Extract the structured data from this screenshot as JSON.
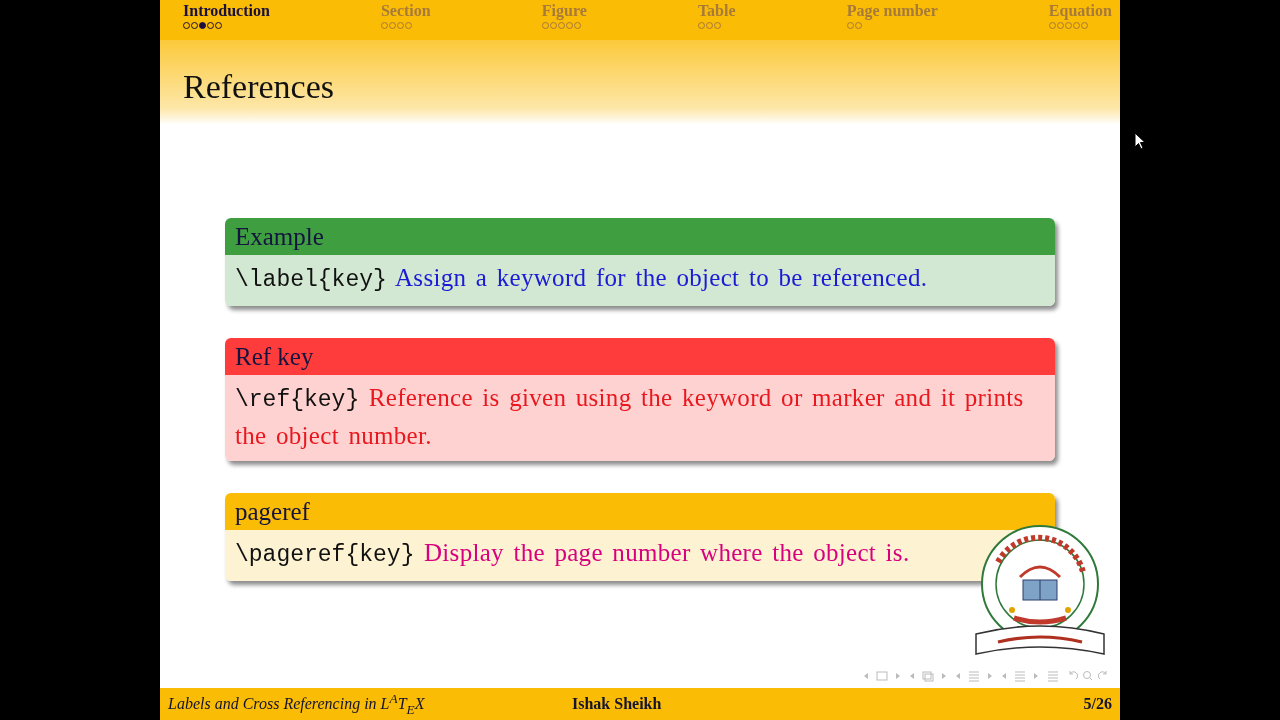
{
  "nav": {
    "sections": [
      {
        "label": "Introduction",
        "selected": true,
        "frames": [
          {
            "selected": false
          },
          {
            "selected": false
          },
          {
            "selected": true
          },
          {
            "selected": false
          },
          {
            "selected": false
          }
        ]
      },
      {
        "label": "Section",
        "selected": false,
        "frames": [
          {
            "selected": false
          },
          {
            "selected": false
          },
          {
            "selected": false
          },
          {
            "selected": false
          }
        ]
      },
      {
        "label": "Figure",
        "selected": false,
        "frames": [
          {
            "selected": false
          },
          {
            "selected": false
          },
          {
            "selected": false
          },
          {
            "selected": false
          },
          {
            "selected": false
          }
        ]
      },
      {
        "label": "Table",
        "selected": false,
        "frames": [
          {
            "selected": false
          },
          {
            "selected": false
          },
          {
            "selected": false
          }
        ]
      },
      {
        "label": "Page number",
        "selected": false,
        "frames": [
          {
            "selected": false
          },
          {
            "selected": false
          }
        ]
      },
      {
        "label": "Equation",
        "selected": false,
        "frames": [
          {
            "selected": false
          },
          {
            "selected": false
          },
          {
            "selected": false
          },
          {
            "selected": false
          },
          {
            "selected": false
          }
        ]
      }
    ]
  },
  "frame_title": "References",
  "blocks": [
    {
      "kind": "example",
      "title": "Example",
      "code": "\\label{key}",
      "text": "Assign a keyword for the object to be referenced."
    },
    {
      "kind": "alert",
      "title": "Ref key",
      "code": "\\ref{key}",
      "text": "Reference is given using the keyword or marker and it prints the object number."
    },
    {
      "kind": "standard",
      "title": "pageref",
      "code": "\\pageref{key}",
      "text": "Display the page number where the object is."
    }
  ],
  "footer": {
    "title": "Labels and Cross Referencing in L$^{A}$T$_{E}$X",
    "author": "Ishak Sheikh",
    "page": "5/26"
  }
}
